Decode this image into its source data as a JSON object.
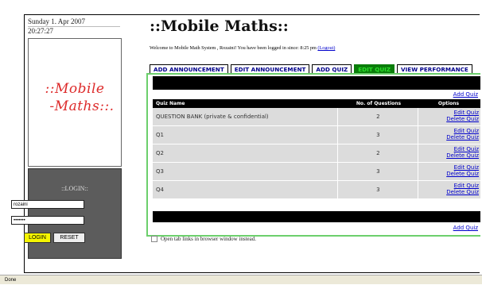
{
  "date": "Sunday 1. Apr 2007",
  "time": "20:27:27",
  "logo": {
    "line1": "::Mobile",
    "line2": "-Maths::."
  },
  "login": {
    "title": "::LOGIN::",
    "username": "rozaini",
    "password": "•••••••",
    "login_label": "LOGIN",
    "reset_label": "RESET"
  },
  "header": {
    "title": "::Mobile Maths::",
    "welcome_text": "Welcome to Mobile Math System , Rozaini! You have been logged in since: 8:25 pm",
    "logout_label": "(Logout)"
  },
  "tabs": [
    {
      "label": "ADD ANNOUNCEMENT"
    },
    {
      "label": "EDIT ANNOUNCEMENT"
    },
    {
      "label": "ADD QUIZ"
    },
    {
      "label": "EDIT QUIZ",
      "active": true
    },
    {
      "label": "VIEW PERFORMANCE"
    }
  ],
  "table": {
    "add_quiz_label": "Add Quiz",
    "headers": {
      "name": "Quiz Name",
      "num": "No. of Questions",
      "options": "Options"
    },
    "edit_label": "Edit Quiz",
    "delete_label": "Delete Quiz",
    "rows": [
      {
        "name": "QUESTION BANK (private & confidential)",
        "num": "2"
      },
      {
        "name": "Q1",
        "num": "3"
      },
      {
        "name": "Q2",
        "num": "2"
      },
      {
        "name": "Q3",
        "num": "3"
      },
      {
        "name": "Q4",
        "num": "3"
      }
    ]
  },
  "checkbox_label": "Open tab links in browser window instead.",
  "status": "Done",
  "colors": {
    "active_tab_bg": "#0a7d0a",
    "active_tab_text": "#2be02b",
    "logo_red": "#dd2a2a",
    "content_border": "#6ccf6c"
  }
}
